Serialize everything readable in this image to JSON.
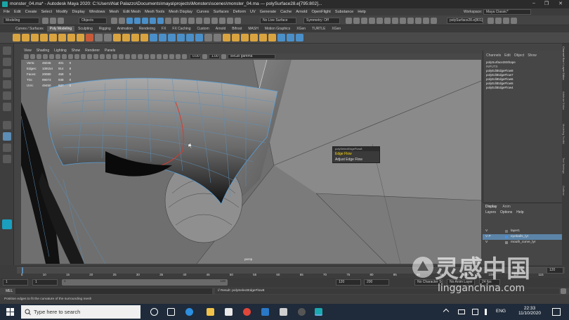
{
  "window": {
    "title": "monster_04.ma* - Autodesk Maya 2020: C:\\Users\\Nat Palazzo\\Documents\\maya\\projects\\Monsters\\scenes\\monster_04.ma --- polySurface28.e[795:802]...",
    "controls": [
      "–",
      "❐",
      "✕"
    ]
  },
  "menubar": {
    "items": [
      "File",
      "Edit",
      "Create",
      "Select",
      "Modify",
      "Display",
      "Windows",
      "Mesh",
      "Edit Mesh",
      "Mesh Tools",
      "Mesh Display",
      "Curves",
      "Surfaces",
      "Deform",
      "UV",
      "Generate",
      "Cache",
      "Arnold",
      "OpenFlight",
      "Substance",
      "Help"
    ],
    "workspace_label": "Workspace:",
    "workspace_value": "Maya Classic*"
  },
  "statusline": {
    "mode": "Modeling",
    "objects": "Objects",
    "live_surface": "No Live Surface",
    "symmetry": "Symmetry: Off",
    "object_name": "polySurface28.e[801]"
  },
  "shelf": {
    "tabs": [
      "Curves / Surfaces",
      "Poly Modeling",
      "Sculpting",
      "Rigging",
      "Animation",
      "Rendering",
      "FX",
      "FX Caching",
      "Custom",
      "Arnold",
      "Bifrost",
      "MASH",
      "Motion Graphics",
      "XGen",
      "TURTLE",
      "XGen"
    ],
    "active_tab": "Poly Modeling"
  },
  "viewport": {
    "menu": [
      "View",
      "Shading",
      "Lighting",
      "Show",
      "Renderer",
      "Panels"
    ],
    "num_field_a": "0.00",
    "num_field_b": "1.00",
    "colorspace": "sRGB gamma",
    "hud": {
      "rows": [
        {
          "label": "Verts:",
          "a": "45046",
          "b": "401",
          "c": "0"
        },
        {
          "label": "Edges:",
          "a": "109154",
          "b": "914",
          "c": "8"
        },
        {
          "label": "Faces:",
          "a": "20080",
          "b": "468",
          "c": "0"
        },
        {
          "label": "Tris:",
          "a": "99073",
          "b": "938",
          "c": "0"
        },
        {
          "label": "UVs:",
          "a": "49450",
          "b": "837",
          "c": "0"
        }
      ]
    },
    "camera_label": "persp"
  },
  "marking_menu": {
    "header": "polySelectEdgeFlow8",
    "items": [
      "Edge Flow",
      "Adjust Edge Flow"
    ]
  },
  "channel_box": {
    "tabs": [
      "Channels",
      "Edit",
      "Object",
      "Show"
    ],
    "object": "polySurface28Shape",
    "inputs_label": "INPUTS",
    "nodes": [
      "polyEditEdgeFlow8",
      "polyEditEdgeFlow7",
      "polyEditEdgeFlow6",
      "polyEditEdgeFlow5",
      "polyEditEdgeFlow4"
    ],
    "side_tabs": [
      "Channel Box / Layer Editor",
      "Attribute Editor",
      "Modeling Toolkit",
      "Tool Settings",
      "Outliner"
    ]
  },
  "layer_editor": {
    "tabs": [
      "Display",
      "Anim"
    ],
    "menu": [
      "Layers",
      "Options",
      "Help"
    ],
    "layers": [
      {
        "name": "layer1",
        "color": "#777777",
        "vis": "V",
        "selected": false
      },
      {
        "name": "eyeballs_lyr",
        "color": "#4a90e2",
        "vis": "V  P",
        "selected": true
      },
      {
        "name": "mouth_curve_lyr",
        "color": "#888888",
        "vis": "V",
        "selected": false
      }
    ]
  },
  "time_slider": {
    "ticks": [
      "5",
      "10",
      "15",
      "20",
      "25",
      "30",
      "35",
      "40",
      "45",
      "50",
      "55",
      "60",
      "65",
      "70",
      "75",
      "80",
      "85",
      "90",
      "95",
      "100",
      "105",
      "110",
      "115"
    ],
    "current_frame": "120"
  },
  "range_slider": {
    "start": "1",
    "start_b": "1",
    "range_start": "1",
    "range_end": "120",
    "end_a": "120",
    "end_b": "200",
    "char_set": "No Character Set",
    "anim_layer": "No Anim Layer",
    "fps": "24 fps"
  },
  "command_line": {
    "lang": "MEL",
    "result": "// Result: polySelectEdgeFlow8"
  },
  "help_line": {
    "text": "Position edges to fit the curvature of the surrounding mesh"
  },
  "taskbar": {
    "search_placeholder": "Type here to search",
    "lang": "ENG",
    "time": "22:33",
    "date": "11/10/2020"
  },
  "watermark": {
    "chinese": "灵感中国",
    "url": "lingganchina.com"
  }
}
